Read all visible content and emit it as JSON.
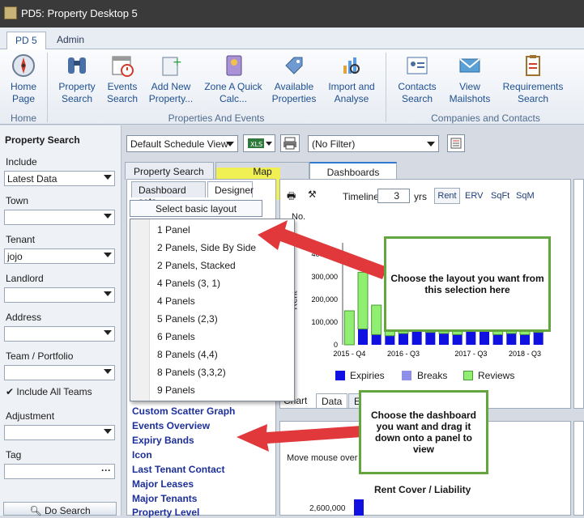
{
  "window": {
    "title": "PD5: Property Desktop 5"
  },
  "ribbon_tabs": [
    {
      "label": "PD 5"
    },
    {
      "label": "Admin"
    }
  ],
  "ribbon": {
    "home": {
      "label": "Home Page",
      "group": "Home"
    },
    "properties": {
      "group": "Properties And Events",
      "buttons": [
        {
          "label": "Property Search",
          "icon": "binoculars-icon"
        },
        {
          "label": "Events Search",
          "icon": "calendar-icon"
        },
        {
          "label": "Add New Property...",
          "icon": "add-property-icon"
        },
        {
          "label": "Zone A Quick Calc...",
          "icon": "calculator-icon"
        },
        {
          "label": "Available Properties",
          "icon": "tag-icon"
        },
        {
          "label": "Import and Analyse",
          "icon": "chart-magnifier-icon"
        }
      ]
    },
    "contacts": {
      "group": "Companies and Contacts",
      "buttons": [
        {
          "label": "Contacts Search",
          "icon": "contact-card-icon"
        },
        {
          "label": "View Mailshots",
          "icon": "envelope-icon"
        },
        {
          "label": "Requirements Search",
          "icon": "clipboard-icon"
        }
      ]
    }
  },
  "left": {
    "title": "Property Search",
    "include_label": "Include",
    "include_value": "Latest Data",
    "town_label": "Town",
    "town_value": "",
    "tenant_label": "Tenant",
    "tenant_value": "jojo",
    "landlord_label": "Landlord",
    "landlord_value": "",
    "address_label": "Address",
    "address_value": "",
    "team_label": "Team / Portfolio",
    "team_value": "",
    "include_all_label": "Include All Teams",
    "include_all_checked": true,
    "adjustment_label": "Adjustment",
    "adjustment_value": "",
    "tag_label": "Tag",
    "tag_value": "",
    "search_button": "Do Search"
  },
  "toolbar": {
    "schedule_view": "Default Schedule View",
    "filter": "(No Filter)"
  },
  "main_tabs": [
    {
      "label": "Property Search"
    },
    {
      "label": "Map"
    },
    {
      "label": "Dashboards"
    }
  ],
  "sub_tabs": [
    {
      "label": "Dashboard sets"
    },
    {
      "label": "Designer"
    }
  ],
  "designer": {
    "select_layout": "Select basic layout",
    "layouts": [
      "1 Panel",
      "2 Panels, Side By Side",
      "2 Panels, Stacked",
      "4 Panels (3, 1)",
      "4 Panels",
      "5 Panels (2,3)",
      "6 Panels",
      "8 Panels (4,4)",
      "8 Panels (3,3,2)",
      "9 Panels"
    ],
    "dashboards": [
      "Custom Scatter Graph",
      "Events Overview",
      "Expiry Bands",
      "Icon",
      "Last Tenant Contact",
      "Major Leases",
      "Major Tenants",
      "Property Level"
    ]
  },
  "chart_panel": {
    "timeline_label": "Timeline",
    "timeline_value": "3",
    "yrs_label": "yrs",
    "measure_buttons": [
      "Rent",
      "ERV",
      "SqFt",
      "SqM"
    ],
    "no_label": "No.",
    "y_label": "Rent",
    "bottom_tabs": [
      "Chart",
      "Data",
      "E"
    ]
  },
  "chart_data": {
    "type": "bar",
    "categories": [
      "2015 - Q4",
      "",
      "",
      "",
      "2016 - Q3",
      "",
      "",
      "",
      "",
      "2017 - Q3",
      "",
      "",
      "",
      "2018 - Q3",
      ""
    ],
    "ylim": [
      0,
      450000
    ],
    "yticks": [
      0,
      100000,
      200000,
      300000,
      400000
    ],
    "series": [
      {
        "name": "Expiries",
        "color": "#1010e0",
        "values": [
          0,
          70000,
          45000,
          40000,
          50000,
          60000,
          55000,
          50000,
          45000,
          60000,
          60000,
          45000,
          50000,
          45000,
          55000
        ]
      },
      {
        "name": "Breaks",
        "color": "#8f8fe8",
        "values": [
          0,
          0,
          0,
          0,
          0,
          0,
          0,
          0,
          0,
          0,
          0,
          0,
          0,
          0,
          0
        ]
      },
      {
        "name": "Reviews",
        "color": "#90ee70",
        "values": [
          150000,
          250000,
          130000,
          80000,
          90000,
          85000,
          75000,
          120000,
          95000,
          110000,
          90000,
          85000,
          120000,
          20000,
          70000
        ]
      }
    ],
    "legend": [
      "Expiries",
      "Breaks",
      "Reviews"
    ]
  },
  "second_panel": {
    "hint": "Move mouse over c",
    "title": "Rent Cover / Liability",
    "tick": "2,600,000"
  },
  "callouts": [
    "Choose the layout you want from this selection here",
    "Choose the dashboard you want and drag it down onto a panel to view"
  ]
}
